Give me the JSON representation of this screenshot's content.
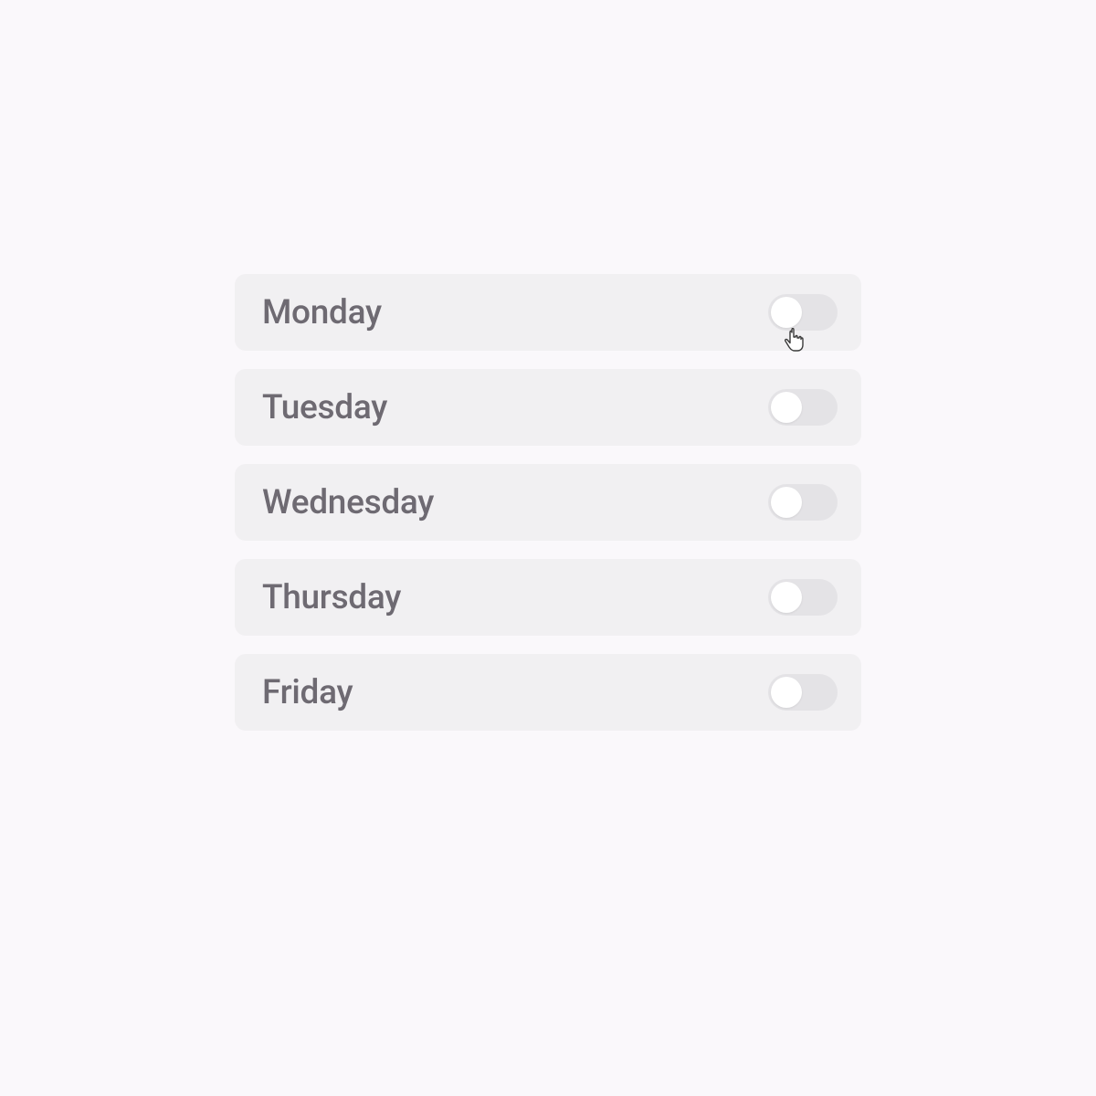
{
  "days": {
    "items": [
      {
        "label": "Monday",
        "on": false
      },
      {
        "label": "Tuesday",
        "on": false
      },
      {
        "label": "Wednesday",
        "on": false
      },
      {
        "label": "Thursday",
        "on": false
      },
      {
        "label": "Friday",
        "on": false
      }
    ]
  },
  "colors": {
    "background": "#faf8fb",
    "row": "#f1f0f2",
    "track": "#e4e3e6",
    "knob": "#ffffff",
    "text": "#6e6a72"
  }
}
